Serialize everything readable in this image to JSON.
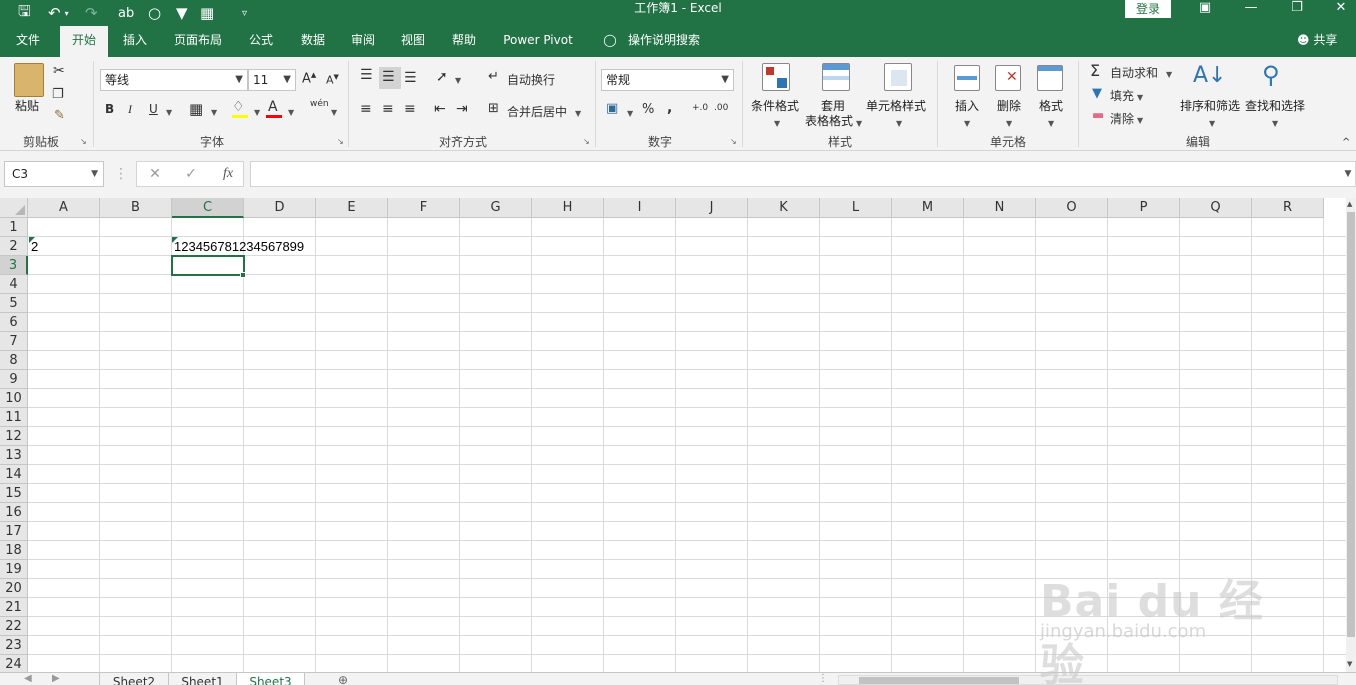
{
  "window": {
    "title": "工作簿1  -  Excel",
    "login": "登录"
  },
  "quick_access": [
    "save-icon",
    "undo-icon",
    "redo-icon",
    "spelling-icon",
    "circle-icon",
    "filter-icon",
    "form-icon",
    "customize-icon"
  ],
  "tabs": [
    {
      "label": "文件"
    },
    {
      "label": "开始"
    },
    {
      "label": "插入"
    },
    {
      "label": "页面布局"
    },
    {
      "label": "公式"
    },
    {
      "label": "数据"
    },
    {
      "label": "审阅"
    },
    {
      "label": "视图"
    },
    {
      "label": "帮助"
    },
    {
      "label": "Power Pivot"
    },
    {
      "label": "操作说明搜索"
    }
  ],
  "share": "共享",
  "ribbon": {
    "clipboard": {
      "paste": "粘贴",
      "label": "剪贴板"
    },
    "font": {
      "name": "等线",
      "size": "11",
      "bold": "B",
      "italic": "I",
      "underline": "U",
      "grow": "A",
      "shrink": "A",
      "color_letter": "A",
      "phonetic": "wén",
      "label": "字体"
    },
    "alignment": {
      "wrap": "自动换行",
      "merge": "合并后居中",
      "label": "对齐方式"
    },
    "number": {
      "format": "常规",
      "percent": "%",
      "comma": ",",
      "label": "数字"
    },
    "styles": {
      "conditional": "条件格式",
      "table_line1": "套用",
      "table_line2": "表格格式",
      "cell_styles": "单元格样式",
      "label": "样式"
    },
    "cells": {
      "insert": "插入",
      "delete": "删除",
      "format": "格式",
      "label": "单元格"
    },
    "editing": {
      "autosum": "自动求和",
      "fill": "填充",
      "clear": "清除",
      "sort": "排序和筛选",
      "find": "查找和选择",
      "label": "编辑"
    }
  },
  "formula_bar": {
    "name_box": "C3",
    "fx": "fx",
    "cancel": "✕",
    "enter": "✓",
    "value": ""
  },
  "columns": [
    "A",
    "B",
    "C",
    "D",
    "E",
    "F",
    "G",
    "H",
    "I",
    "J",
    "K",
    "L",
    "M",
    "N",
    "O",
    "P",
    "Q",
    "R"
  ],
  "rows": [
    "1",
    "2",
    "3",
    "4",
    "5",
    "6",
    "7",
    "8",
    "9",
    "10",
    "11",
    "12",
    "13",
    "14",
    "15",
    "16",
    "17",
    "18",
    "19",
    "20",
    "21",
    "22",
    "23",
    "24"
  ],
  "selected_cell": "C3",
  "cells": {
    "A2": "2",
    "C2": "123456781234567899"
  },
  "sheets": [
    {
      "label": "Sheet2"
    },
    {
      "label": "Sheet1"
    },
    {
      "label": "Sheet3"
    }
  ],
  "active_sheet": "Sheet3",
  "watermark": {
    "logo": "Bai du 经验",
    "url": "jingyan.baidu.com"
  }
}
